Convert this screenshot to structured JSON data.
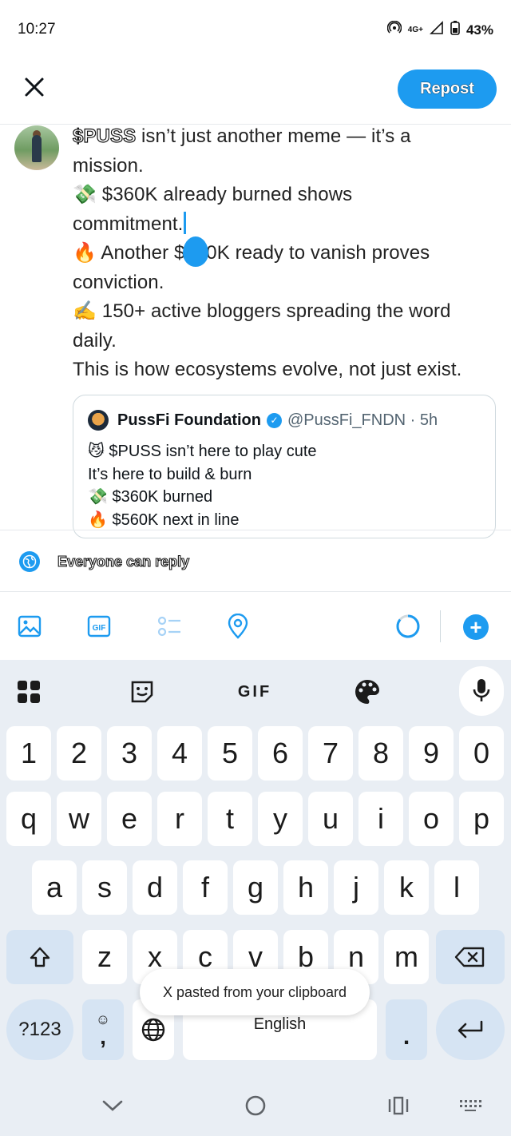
{
  "status_bar": {
    "time": "10:27",
    "network": "4G+",
    "battery": "43%"
  },
  "header": {
    "close_icon": "close-icon",
    "repost_label": "Repost"
  },
  "composer": {
    "cashtag": "$PUSS",
    "lines": {
      "l1_rest": " isn’t just another meme — it’s a",
      "l2": "mission.",
      "l3": "💸 $360K already burned shows",
      "l4": "commitment.",
      "l5": "🔥 Another $560K ready to vanish proves",
      "l6": "conviction.",
      "l7": "✍️ 150+ active bloggers spreading the word",
      "l8": "daily.",
      "l9": "This is how ecosystems evolve, not just exist."
    }
  },
  "quote": {
    "name": "PussFi Foundation",
    "handle": "@PussFi_FNDN · 5h",
    "lines": {
      "l1": "😼 $PUSS isn’t here to play cute",
      "l2": "It’s here to build & burn",
      "l3": "💸 $360K burned",
      "l4": "🔥 $560K next in line"
    }
  },
  "reply_setting": {
    "label": "Everyone can reply"
  },
  "toolbar": {
    "gif_label": "GIF"
  },
  "keyboard": {
    "gif_label": "GIF",
    "number_row": [
      "1",
      "2",
      "3",
      "4",
      "5",
      "6",
      "7",
      "8",
      "9",
      "0"
    ],
    "row1": [
      "q",
      "w",
      "e",
      "r",
      "t",
      "y",
      "u",
      "i",
      "o",
      "p"
    ],
    "row2": [
      "a",
      "s",
      "d",
      "f",
      "g",
      "h",
      "j",
      "k",
      "l"
    ],
    "row3": [
      "z",
      "x",
      "c",
      "v",
      "b",
      "n",
      "m"
    ],
    "symbols_label": "?123",
    "space_label": "English",
    "period_label": ".",
    "comma_label": ","
  },
  "toast": {
    "text": "X pasted from your clipboard"
  },
  "colors": {
    "accent": "#1d9bf0",
    "keyboard_bg": "#e9eef4",
    "mod_key": "#d6e4f3"
  }
}
